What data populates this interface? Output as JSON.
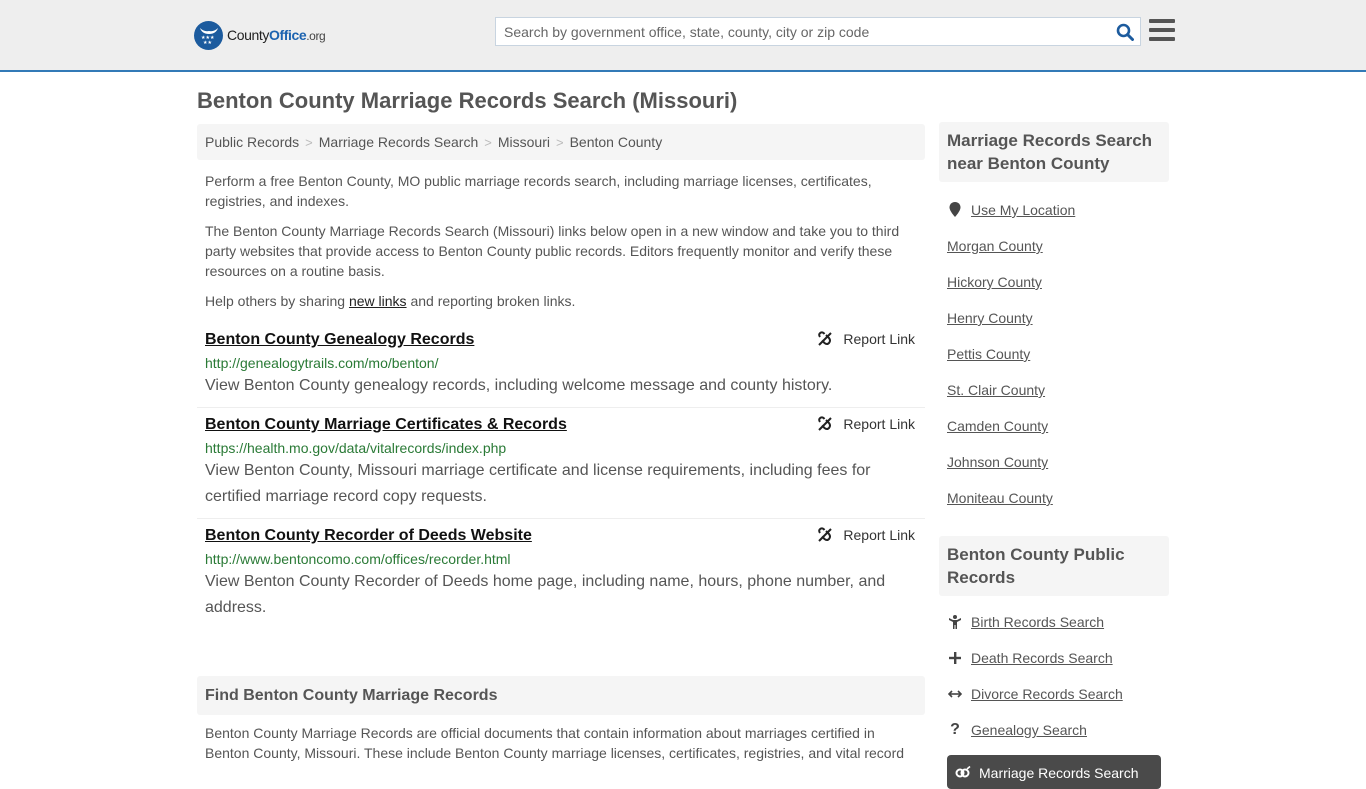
{
  "header": {
    "logo": {
      "prefix": "County",
      "highlight": "Office",
      "suffix": ".org",
      "badge_icon": "eagle-stars-icon"
    },
    "search": {
      "placeholder": "Search by government office, state, county, city or zip code",
      "value": "",
      "icon": "search-icon"
    },
    "menu_icon": "hamburger-menu-icon",
    "accent_color": "#337ab7"
  },
  "page": {
    "title": "Benton County Marriage Records Search (Missouri)"
  },
  "breadcrumb": [
    {
      "label": "Public Records"
    },
    {
      "label": "Marriage Records Search"
    },
    {
      "label": "Missouri"
    },
    {
      "label": "Benton County"
    }
  ],
  "breadcrumb_separator": ">",
  "intro": {
    "p1": "Perform a free Benton County, MO public marriage records search, including marriage licenses, certificates, registries, and indexes.",
    "p2": "The Benton County Marriage Records Search (Missouri) links below open in a new window and take you to third party websites that provide access to Benton County public records. Editors frequently monitor and verify these resources on a routine basis.",
    "p3_before": "Help others by sharing ",
    "p3_link": "new links",
    "p3_after": " and reporting broken links."
  },
  "links": [
    {
      "title": "Benton County Genealogy Records",
      "url": "http://genealogytrails.com/mo/benton/",
      "description": "View Benton County genealogy records, including welcome message and county history.",
      "report_label": "Report Link"
    },
    {
      "title": "Benton County Marriage Certificates & Records",
      "url": "https://health.mo.gov/data/vitalrecords/index.php",
      "description": "View Benton County, Missouri marriage certificate and license requirements, including fees for certified marriage record copy requests.",
      "report_label": "Report Link"
    },
    {
      "title": "Benton County Recorder of Deeds Website",
      "url": "http://www.bentoncomo.com/offices/recorder.html",
      "description": "View Benton County Recorder of Deeds home page, including name, hours, phone number, and address.",
      "report_label": "Report Link"
    }
  ],
  "find_section": {
    "heading": "Find Benton County Marriage Records",
    "body": "Benton County Marriage Records are official documents that contain information about marriages certified in Benton County, Missouri. These include Benton County marriage licenses, certificates, registries, and vital record"
  },
  "sidebar": {
    "nearby": {
      "heading": "Marriage Records Search near Benton County",
      "use_location": "Use My Location",
      "counties": [
        "Morgan County",
        "Hickory County",
        "Henry County",
        "Pettis County",
        "St. Clair County",
        "Camden County",
        "Johnson County",
        "Moniteau County"
      ]
    },
    "public_records": {
      "heading": "Benton County Public Records",
      "items": [
        {
          "label": "Birth Records Search",
          "icon": "child-icon"
        },
        {
          "label": "Death Records Search",
          "icon": "cross-icon"
        },
        {
          "label": "Divorce Records Search",
          "icon": "arrows-horizontal-icon"
        },
        {
          "label": "Genealogy Search",
          "icon": "question-icon"
        }
      ],
      "active": {
        "label": "Marriage Records Search",
        "icon": "rings-icon"
      }
    }
  }
}
